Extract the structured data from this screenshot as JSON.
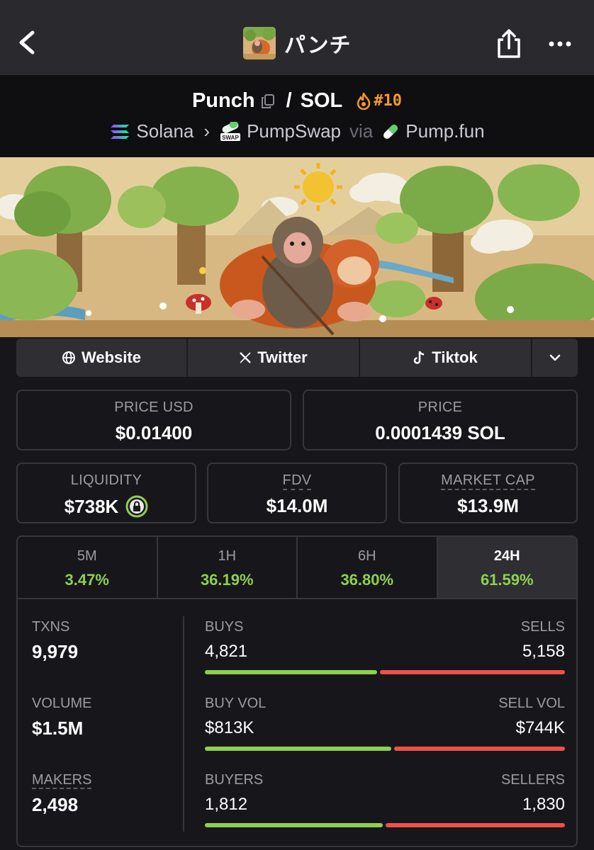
{
  "nav": {
    "title": "パンチ"
  },
  "pair": {
    "base": "Punch",
    "quote": "SOL",
    "separator": "/",
    "rank": "#10",
    "chain": "Solana",
    "dex": "PumpSwap",
    "via_label": "via",
    "launchpad": "Pump.fun"
  },
  "social": [
    {
      "label": "Website",
      "icon": "globe-icon"
    },
    {
      "label": "Twitter",
      "icon": "x-icon"
    },
    {
      "label": "Tiktok",
      "icon": "tiktok-icon"
    }
  ],
  "prices": {
    "price_usd_label": "PRICE USD",
    "price_usd": "$0.01400",
    "price_label": "PRICE",
    "price_native": "0.0001439 SOL"
  },
  "metrics": {
    "liquidity_label": "LIQUIDITY",
    "liquidity": "$738K",
    "fdv_label": "FDV",
    "fdv": "$14.0M",
    "mcap_label": "MARKET CAP",
    "mcap": "$13.9M"
  },
  "tabs": [
    {
      "label": "5M",
      "value": "3.47%"
    },
    {
      "label": "1H",
      "value": "36.19%"
    },
    {
      "label": "6H",
      "value": "36.80%"
    },
    {
      "label": "24H",
      "value": "61.59%"
    }
  ],
  "stats": {
    "txns_label": "TXNS",
    "txns": "9,979",
    "volume_label": "VOLUME",
    "volume": "$1.5M",
    "makers_label": "MAKERS",
    "makers": "2,498",
    "buys_label": "BUYS",
    "buys": "4,821",
    "sells_label": "SELLS",
    "sells": "5,158",
    "buyvol_label": "BUY VOL",
    "buyvol": "$813K",
    "sellvol_label": "SELL VOL",
    "sellvol": "$744K",
    "buyers_label": "BUYERS",
    "buyers": "1,812",
    "sellers_label": "SELLERS",
    "sellers": "1,830",
    "buy_share": 0.483,
    "buyvol_share": 0.522,
    "buyers_share": 0.498
  },
  "colors": {
    "positive": "#8ed04f",
    "negative": "#f0504a",
    "rank": "#f59a23"
  }
}
